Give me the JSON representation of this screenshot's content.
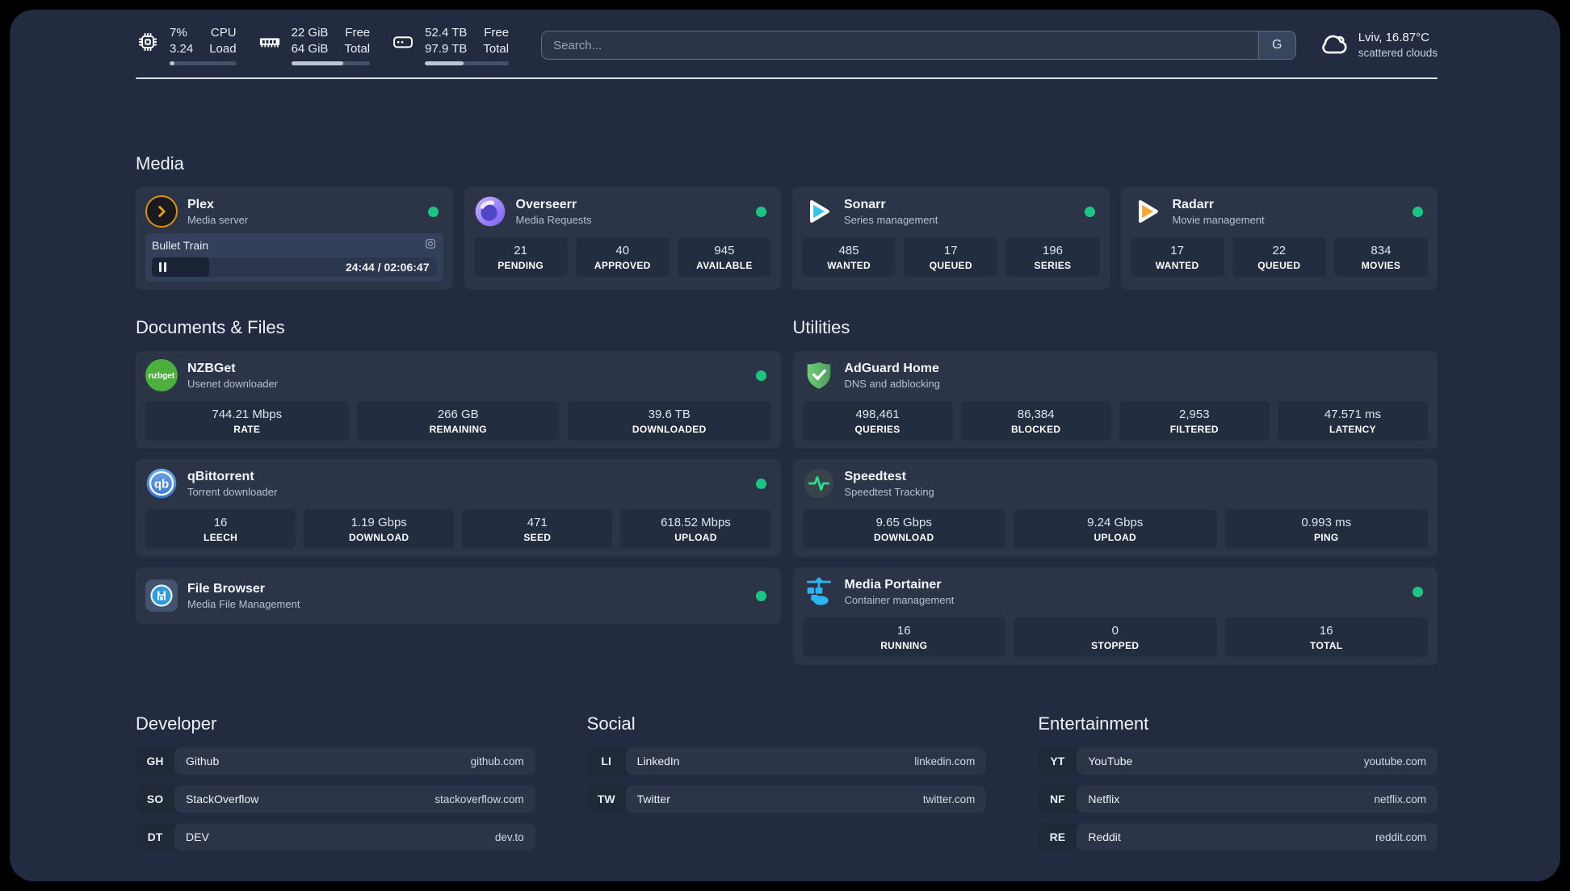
{
  "colors": {
    "status_online": "#1dc584",
    "plex_gold": "#e5a00d",
    "sonarr_blue": "#35c5f4",
    "radarr_orange": "#f7a832",
    "overseerr_purple": "#7a5af8",
    "nzbget_green": "#4caf3e",
    "qbittorrent_blue": "#3a76c8",
    "adguard_green": "#68bd6e",
    "speedtest_pulse": "#27e08d",
    "portainer_blue": "#29b6f6",
    "background": "#222b40",
    "card": "#2b3547"
  },
  "header": {
    "cpu": {
      "value1": "7%",
      "value2": "3.24",
      "label1": "CPU",
      "label2": "Load",
      "bar_pct": 7
    },
    "ram": {
      "value1": "22 GiB",
      "value2": "64 GiB",
      "label1": "Free",
      "label2": "Total",
      "bar_pct": 66
    },
    "disk": {
      "value1": "52.4 TB",
      "value2": "97.9 TB",
      "label1": "Free",
      "label2": "Total",
      "bar_pct": 46
    },
    "search": {
      "placeholder": "Search...",
      "engine_button": "G"
    },
    "weather": {
      "location_temp": "Lviv, 16.87°C",
      "condition": "scattered clouds"
    }
  },
  "media": {
    "title": "Media",
    "plex": {
      "name": "Plex",
      "subtitle": "Media server",
      "now_playing": {
        "title": "Bullet Train",
        "time": "24:44 / 02:06:47",
        "progress_pct": 20
      }
    },
    "overseerr": {
      "name": "Overseerr",
      "subtitle": "Media Requests",
      "stats": [
        {
          "value": "21",
          "label": "PENDING"
        },
        {
          "value": "40",
          "label": "APPROVED"
        },
        {
          "value": "945",
          "label": "AVAILABLE"
        }
      ]
    },
    "sonarr": {
      "name": "Sonarr",
      "subtitle": "Series management",
      "stats": [
        {
          "value": "485",
          "label": "WANTED"
        },
        {
          "value": "17",
          "label": "QUEUED"
        },
        {
          "value": "196",
          "label": "SERIES"
        }
      ]
    },
    "radarr": {
      "name": "Radarr",
      "subtitle": "Movie management",
      "stats": [
        {
          "value": "17",
          "label": "WANTED"
        },
        {
          "value": "22",
          "label": "QUEUED"
        },
        {
          "value": "834",
          "label": "MOVIES"
        }
      ]
    }
  },
  "documents": {
    "title": "Documents & Files",
    "nzbget": {
      "name": "NZBGet",
      "subtitle": "Usenet downloader",
      "stats": [
        {
          "value": "744.21 Mbps",
          "label": "RATE"
        },
        {
          "value": "266 GB",
          "label": "REMAINING"
        },
        {
          "value": "39.6 TB",
          "label": "DOWNLOADED"
        }
      ]
    },
    "qbittorrent": {
      "name": "qBittorrent",
      "subtitle": "Torrent downloader",
      "stats": [
        {
          "value": "16",
          "label": "LEECH"
        },
        {
          "value": "1.19 Gbps",
          "label": "DOWNLOAD"
        },
        {
          "value": "471",
          "label": "SEED"
        },
        {
          "value": "618.52 Mbps",
          "label": "UPLOAD"
        }
      ]
    },
    "filebrowser": {
      "name": "File Browser",
      "subtitle": "Media File Management"
    }
  },
  "utilities": {
    "title": "Utilities",
    "adguard": {
      "name": "AdGuard Home",
      "subtitle": "DNS and adblocking",
      "stats": [
        {
          "value": "498,461",
          "label": "QUERIES"
        },
        {
          "value": "86,384",
          "label": "BLOCKED"
        },
        {
          "value": "2,953",
          "label": "FILTERED"
        },
        {
          "value": "47.571 ms",
          "label": "LATENCY"
        }
      ]
    },
    "speedtest": {
      "name": "Speedtest",
      "subtitle": "Speedtest Tracking",
      "stats": [
        {
          "value": "9.65 Gbps",
          "label": "DOWNLOAD"
        },
        {
          "value": "9.24 Gbps",
          "label": "UPLOAD"
        },
        {
          "value": "0.993 ms",
          "label": "PING"
        }
      ]
    },
    "portainer": {
      "name": "Media Portainer",
      "subtitle": "Container management",
      "stats": [
        {
          "value": "16",
          "label": "RUNNING"
        },
        {
          "value": "0",
          "label": "STOPPED"
        },
        {
          "value": "16",
          "label": "TOTAL"
        }
      ]
    }
  },
  "bookmarks": {
    "developer": {
      "title": "Developer",
      "items": [
        {
          "abbr": "GH",
          "name": "Github",
          "url": "github.com"
        },
        {
          "abbr": "SO",
          "name": "StackOverflow",
          "url": "stackoverflow.com"
        },
        {
          "abbr": "DT",
          "name": "DEV",
          "url": "dev.to"
        }
      ]
    },
    "social": {
      "title": "Social",
      "items": [
        {
          "abbr": "LI",
          "name": "LinkedIn",
          "url": "linkedin.com"
        },
        {
          "abbr": "TW",
          "name": "Twitter",
          "url": "twitter.com"
        }
      ]
    },
    "entertainment": {
      "title": "Entertainment",
      "items": [
        {
          "abbr": "YT",
          "name": "YouTube",
          "url": "youtube.com"
        },
        {
          "abbr": "NF",
          "name": "Netflix",
          "url": "netflix.com"
        },
        {
          "abbr": "RE",
          "name": "Reddit",
          "url": "reddit.com"
        }
      ]
    }
  }
}
